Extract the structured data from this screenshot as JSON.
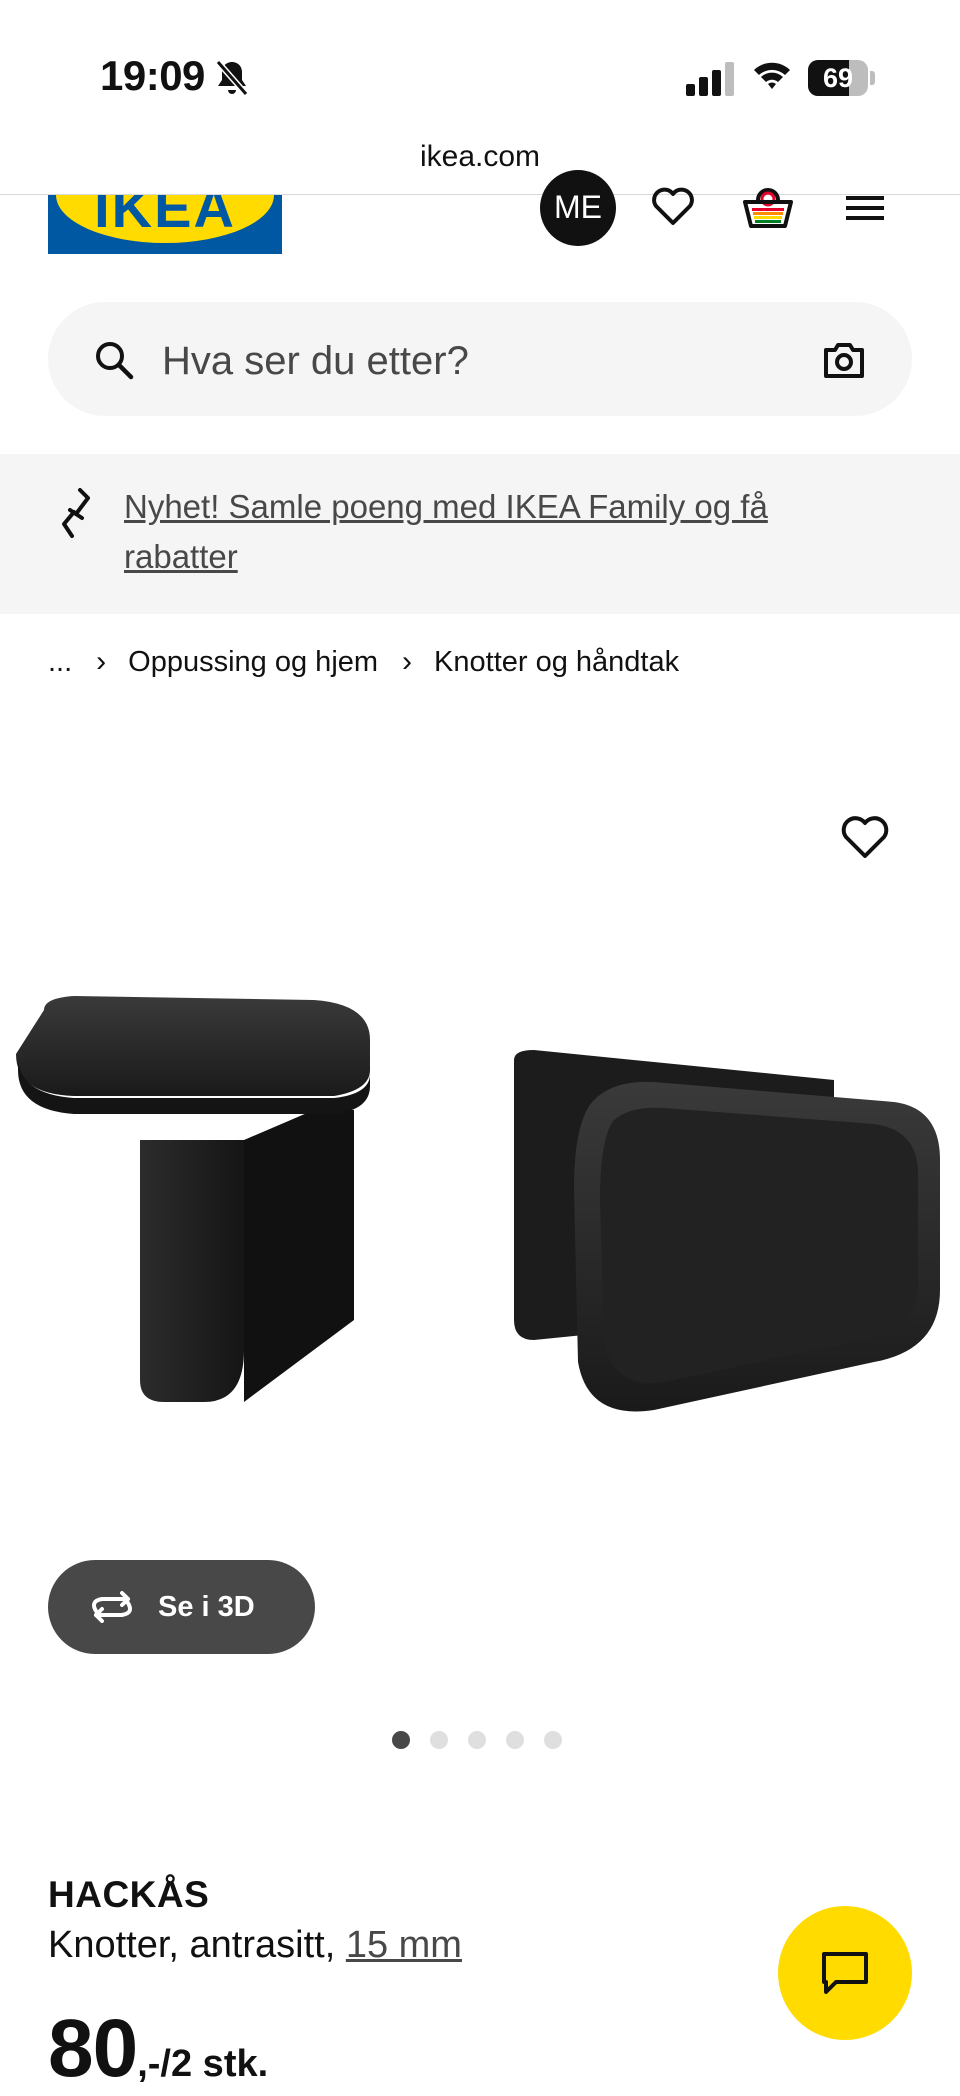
{
  "status_bar": {
    "time": "19:09",
    "battery": "69",
    "battery_level": 0.69
  },
  "browser": {
    "url": "ikea.com"
  },
  "header": {
    "logo_text": "IKEA",
    "avatar_initials": "ME"
  },
  "search": {
    "placeholder": "Hva ser du etter?"
  },
  "promo": {
    "text": "Nyhet! Samle poeng med IKEA Family og få rabatter"
  },
  "breadcrumb": {
    "ellipsis": "...",
    "items": [
      "Oppussing og hjem",
      "Knotter og håndtak"
    ]
  },
  "gallery": {
    "view_3d_label": "Se i 3D",
    "dot_count": 5,
    "active_dot": 0
  },
  "product": {
    "name": "HACKÅS",
    "description": "Knotter, antrasitt,",
    "size": "15 mm",
    "price_integer": "80",
    "price_suffix": ",-/2 stk."
  },
  "colors": {
    "brand_blue": "#0058a3",
    "brand_yellow": "#ffdb00",
    "dark_grey": "#484848",
    "product_black": "#1b1b1b"
  },
  "icons": [
    "bell-slash-icon",
    "signal-icon",
    "wifi-icon",
    "battery-icon",
    "heart-icon",
    "cart-icon",
    "menu-icon",
    "search-icon",
    "camera-icon",
    "link-icon",
    "rotate-3d-icon",
    "chat-icon"
  ]
}
